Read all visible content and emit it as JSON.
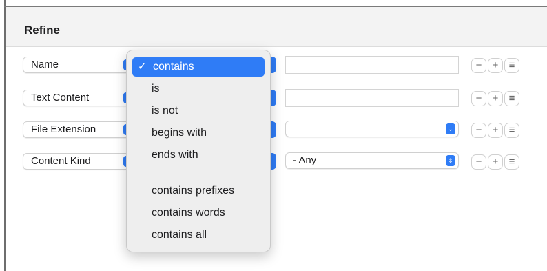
{
  "header": {
    "title": "Refine"
  },
  "rows": [
    {
      "field_label": "Name"
    },
    {
      "field_label": "Text Content"
    },
    {
      "field_label": "File Extension"
    },
    {
      "field_label": "Content Kind",
      "value_label": "- Any"
    }
  ],
  "row_buttons": {
    "remove": "−",
    "add": "+",
    "options": "≡"
  },
  "operator_menu": {
    "items": [
      {
        "label": "contains",
        "selected": true,
        "check": "✓"
      },
      {
        "label": "is"
      },
      {
        "label": "is not"
      },
      {
        "label": "begins with"
      },
      {
        "label": "ends with"
      },
      {
        "label": "contains prefixes"
      },
      {
        "label": "contains words"
      },
      {
        "label": "contains all"
      }
    ]
  },
  "colors": {
    "accent": "#2f7cf6",
    "header_bg": "#f3f3f3",
    "menu_bg": "#eeeeee"
  },
  "icons": {
    "popup": "updown-chevron-icon",
    "chevron": "chevron-down-icon"
  }
}
